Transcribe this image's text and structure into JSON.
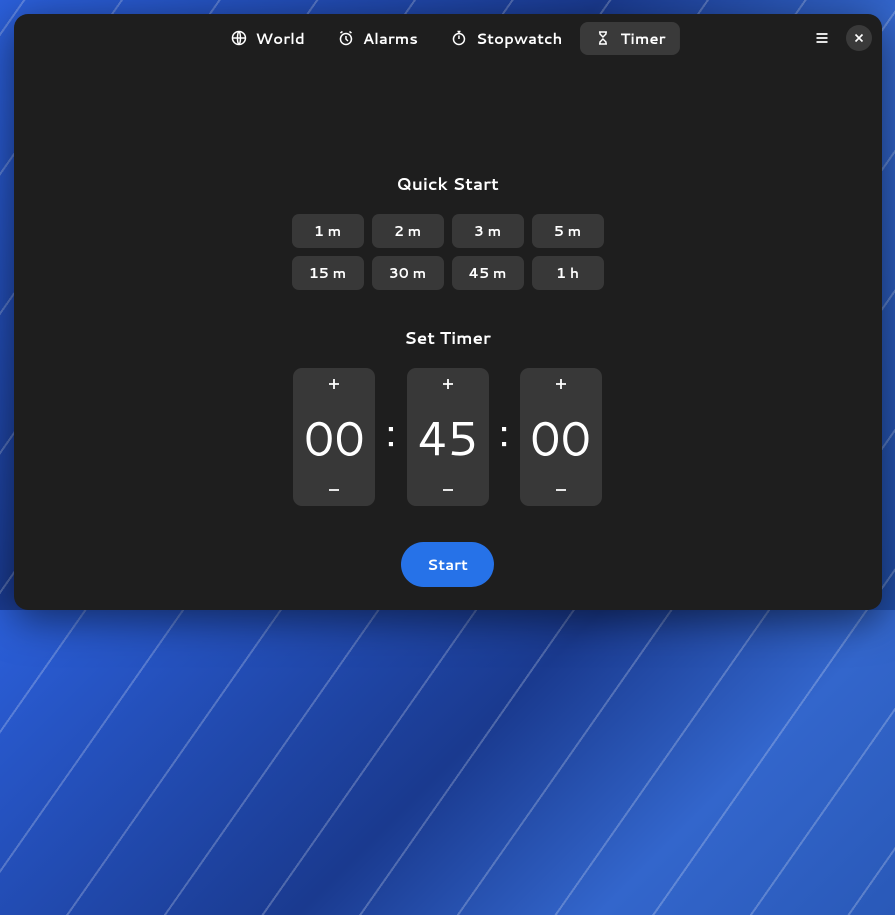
{
  "header": {
    "tabs": [
      {
        "label": "World"
      },
      {
        "label": "Alarms"
      },
      {
        "label": "Stopwatch"
      },
      {
        "label": "Timer"
      }
    ],
    "active_tab": 3
  },
  "quick_start": {
    "title": "Quick Start",
    "presets": [
      "1 m",
      "2 m",
      "3 m",
      "5 m",
      "15 m",
      "30 m",
      "45 m",
      "1 h"
    ]
  },
  "set_timer": {
    "title": "Set Timer",
    "hours": "00",
    "minutes": "45",
    "seconds": "00"
  },
  "start_label": "Start"
}
